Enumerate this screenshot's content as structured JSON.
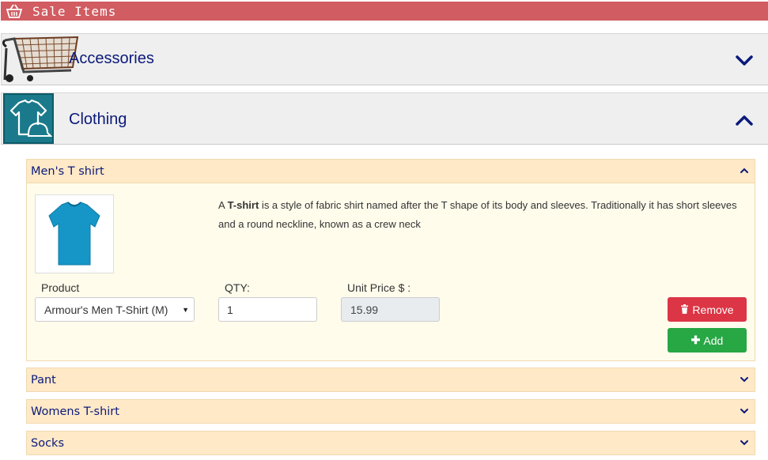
{
  "header": {
    "title": "Sale Items",
    "icon": "basket-icon"
  },
  "categories": [
    {
      "label": "Accessories",
      "icon": "shopping-cart-icon",
      "expanded": false
    },
    {
      "label": "Clothing",
      "icon": "tshirt-cap-icon",
      "expanded": true
    }
  ],
  "items": [
    {
      "label": "Men's T shirt",
      "expanded": true
    },
    {
      "label": "Pant",
      "expanded": false
    },
    {
      "label": "Womens T-shirt",
      "expanded": false
    },
    {
      "label": "Socks",
      "expanded": false
    }
  ],
  "detail": {
    "image": "blue-tshirt",
    "description_pre": "A ",
    "description_bold": "T-shirt",
    "description_post": " is a style of fabric shirt named after the T shape of its body and sleeves. Traditionally it has short sleeves and a round neckline, known as a crew neck",
    "product_label": "Product",
    "product_value": "Armour's Men T-Shirt (M)",
    "qty_label": "QTY:",
    "qty_value": "1",
    "price_label": "Unit Price $ :",
    "price_value": "15.99",
    "remove_label": "Remove",
    "add_label": "Add"
  },
  "colors": {
    "header_bg": "#d15c61",
    "category_bg": "#efefef",
    "category_text": "#0b1a7a",
    "panel_bg": "#ffe9c7",
    "body_bg": "#fffcec",
    "remove": "#dc3545",
    "add": "#28a745"
  }
}
